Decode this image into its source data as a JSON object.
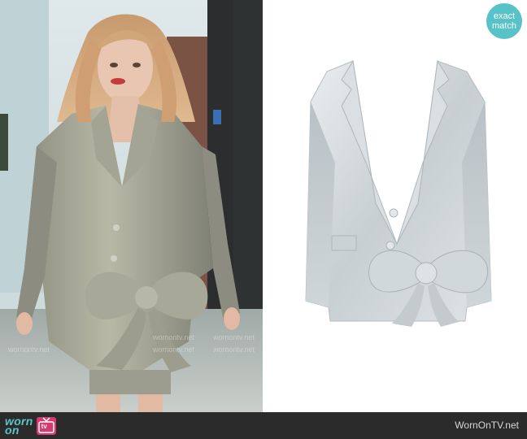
{
  "badge": {
    "line1": "exact",
    "line2": "match"
  },
  "footer": {
    "brand_line1": "worn",
    "brand_line2": "on",
    "brand_tv": "tv",
    "site": "WornOnTV.net"
  },
  "watermark": {
    "text": "wornontv.net"
  },
  "colors": {
    "accent": "#57c3c9",
    "footer_bg": "#2b2b2b",
    "tv_icon": "#d63a6f"
  }
}
